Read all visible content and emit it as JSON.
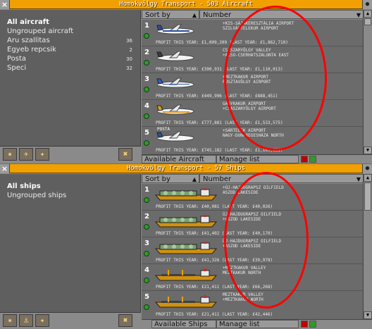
{
  "colors": {
    "titlebar": "#f0a000",
    "status_green": "#2f9a2a",
    "annotation": "#ff0000"
  },
  "aircraft": {
    "title": "Homokvölgy Transport - 503 Aircraft",
    "groups": [
      {
        "label": "All aircraft",
        "count": ""
      },
      {
        "label": "Ungrouped aircraft",
        "count": ""
      },
      {
        "label": "Aru szallitas",
        "count": "36"
      },
      {
        "label": "Egyeb repcsik",
        "count": "2"
      },
      {
        "label": "Posta",
        "count": "30"
      },
      {
        "label": "Speci",
        "count": "32"
      }
    ],
    "sort_by": "Sort by",
    "sort_field": "Number",
    "available_button": "Available Aircraft",
    "manage_button": "Manage list",
    "vehicles": [
      {
        "num": "1",
        "name": "",
        "orders": "+KIS-SÁJAKERESZTÁLIA AIRPORT\nSZILVÁSTELEKUR AIRPORT",
        "profit": "PROFIT THIS YEAR: £1,009,209 (LAST YEAR: £1,862,710)"
      },
      {
        "num": "2",
        "name": "",
        "orders": "CSASZARYÖLGY VALLEY\n+ALSO-CSERHATSZALONTA EAST",
        "profit": "PROFIT THIS YEAR: £390,931 (LAST YEAR: £1,110,013)"
      },
      {
        "num": "3",
        "name": "",
        "orders": "+MEZTKAKUR AIRPORT\nPUSZTAVÖLGY AIRPORT",
        "profit": "PROFIT THIS YEAR: £449,996 (LAST YEAR: £888,451)"
      },
      {
        "num": "4",
        "name": "",
        "orders": "GAGYKAKUR AIRPORT\n+CSASZARYÖLGY AIRPORT",
        "profit": "PROFIT THIS YEAR: £777,881 (LAST YEAR: £1,533,575)"
      },
      {
        "num": "5",
        "name": "POSTA",
        "orders": "+SÁRTELEK AIRPORT\nNAGY-DUNAREGESHÁZA NORTH",
        "profit": "PROFIT THIS YEAR: £745,182 (LAST YEAR: £1,103,681)"
      }
    ]
  },
  "ships": {
    "title": "Homokvölgy Transport - 57 Ships",
    "groups": [
      {
        "label": "All ships",
        "count": ""
      },
      {
        "label": "Ungrouped ships",
        "count": ""
      }
    ],
    "sort_by": "Sort by",
    "sort_field": "Number",
    "available_button": "Available Ships",
    "manage_button": "Manage list",
    "vehicles": [
      {
        "num": "1",
        "orders": "+ÚJ-HAJDUGRAPSZ OILFIELD\nASZOD LAKESIDE",
        "profit": "PROFIT THIS YEAR: £40,081 (LAST YEAR: £40,026)"
      },
      {
        "num": "2",
        "orders": "ÚJ-HAJDUGRAPSZ OILFIELD\n+ASZOD LAKESIDE",
        "profit": "PROFIT THIS YEAR: £41,402 (LAST YEAR: £40,170)"
      },
      {
        "num": "3",
        "orders": "ÚJ-HAJDUGRAPSZ OILFIELD\n+ASZOD LAKESIDE",
        "profit": "PROFIT THIS YEAR: £41,326 (LAST YEAR: £39,978)"
      },
      {
        "num": "4",
        "orders": "+MEZTKAKUR VALLEY\nMEZTKAKUR NORTH",
        "profit": "PROFIT THIS YEAR: £21,411 (LAST YEAR: £66,268)"
      },
      {
        "num": "5",
        "orders": "MEZTKAKUR VALLEY\n+MEZTKAKUR NORTH",
        "profit": "PROFIT THIS YEAR: £21,411 (LAST YEAR: £42,446)"
      }
    ]
  }
}
